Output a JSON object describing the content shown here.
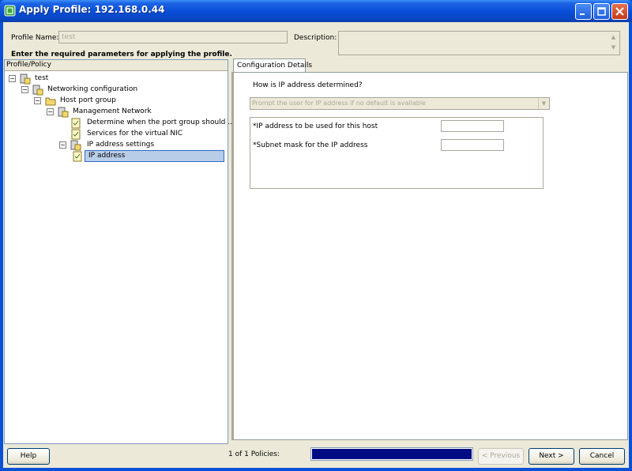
{
  "window": {
    "title": "Apply Profile: 192.168.0.44"
  },
  "form": {
    "profile_name_label": "Profile Name:",
    "profile_name_value": "test",
    "description_label": "Description:",
    "description_value": "",
    "instruction": "Enter the required parameters for applying the profile."
  },
  "tree": {
    "header": "Profile/Policy",
    "nodes": [
      {
        "label": "test",
        "expander": "−"
      },
      {
        "label": "Networking configuration",
        "expander": "−"
      },
      {
        "label": "Host port group",
        "expander": "−"
      },
      {
        "label": "Management Network",
        "expander": "−"
      },
      {
        "label": "Determine when the port group should ..."
      },
      {
        "label": "Services for the virtual NIC"
      },
      {
        "label": "IP address settings",
        "expander": "−"
      },
      {
        "label": "IP address",
        "selected": true
      }
    ]
  },
  "details": {
    "tab_label": "Configuration Details",
    "question": "How is IP address determined?",
    "combo_value": "Prompt the user for IP address if no default is available",
    "params": [
      {
        "label": "*IP address to be used for this host",
        "value": ""
      },
      {
        "label": "*Subnet mask for the IP address",
        "value": ""
      }
    ]
  },
  "footer": {
    "help_label": "Help",
    "policies_text": "1 of 1 Policies:",
    "progress": 1.0,
    "previous_label": "< Previous",
    "next_label": "Next >",
    "cancel_label": "Cancel"
  },
  "colors": {
    "titlebar": "#0a50d8",
    "progress_fill": "#000c84",
    "selection": "#b8cde8"
  }
}
